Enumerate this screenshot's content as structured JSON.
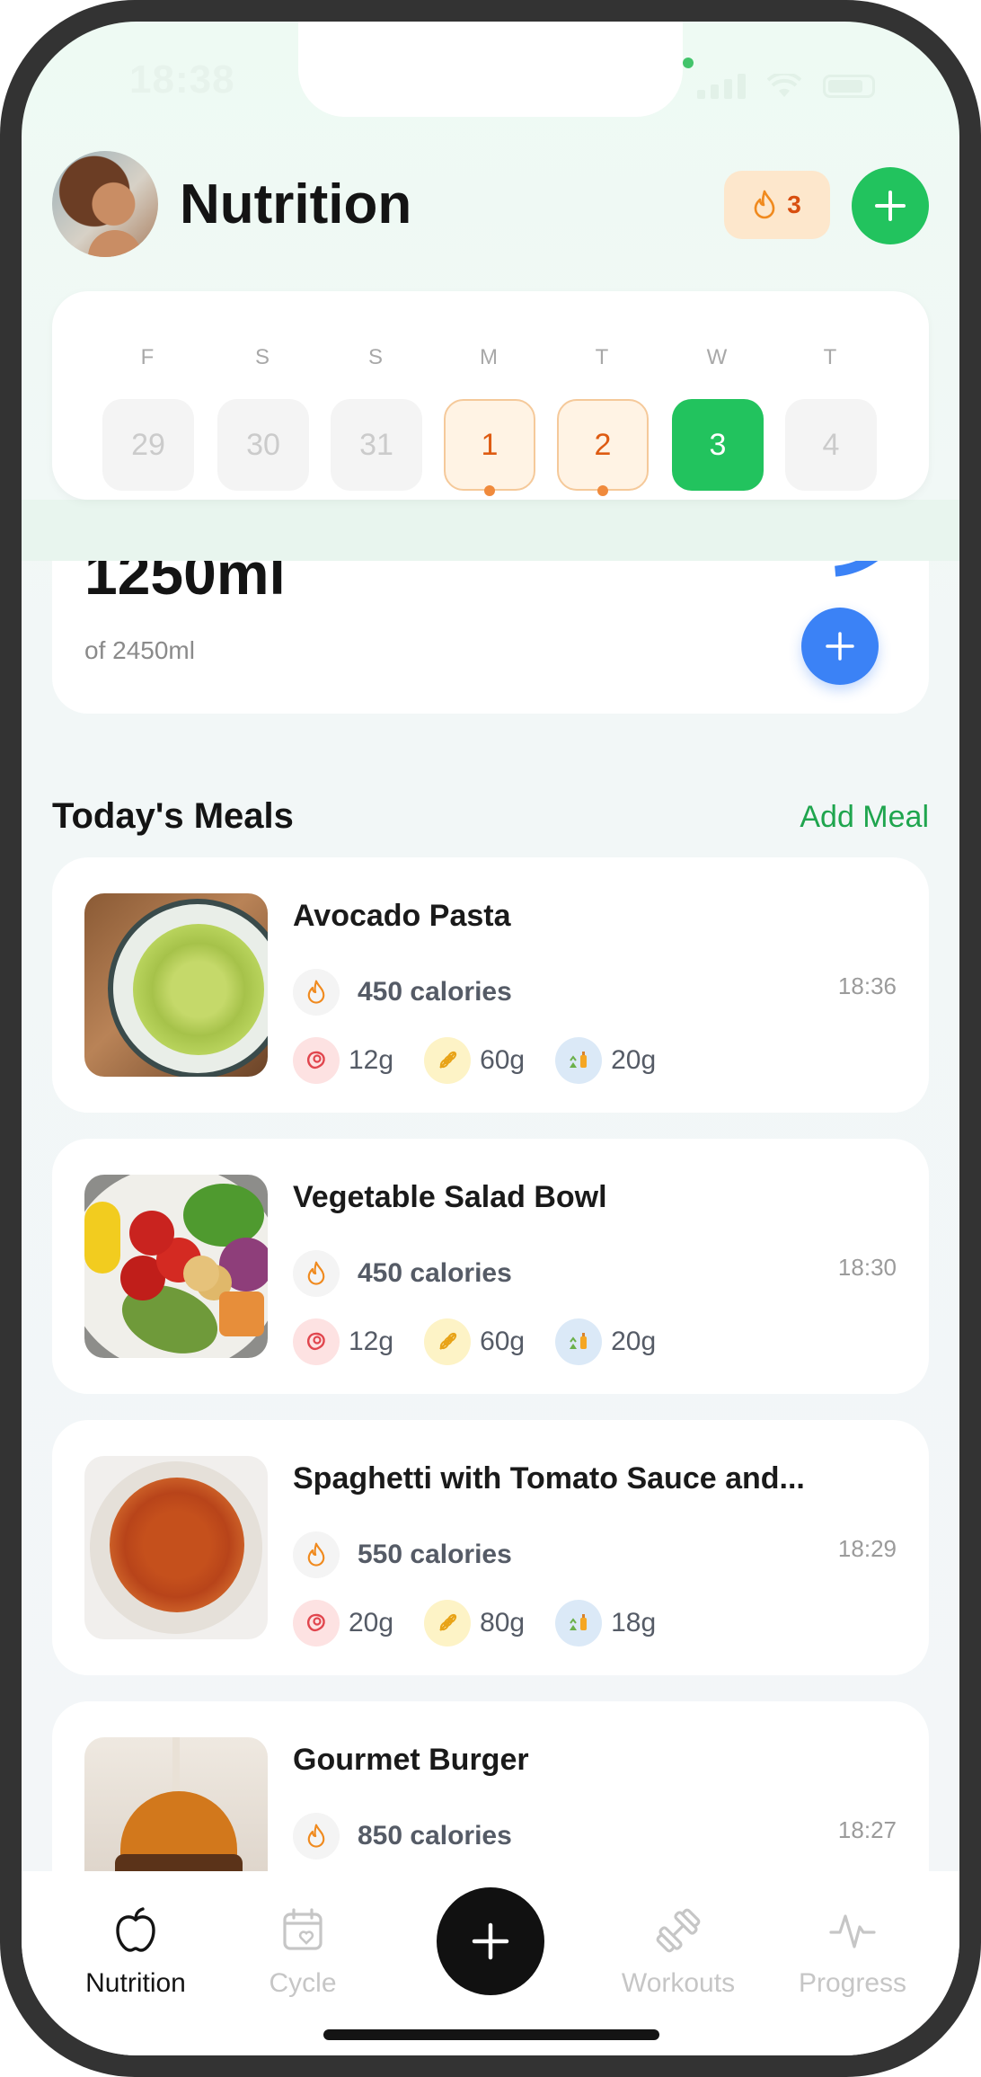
{
  "status": {
    "time": "18:38"
  },
  "header": {
    "title": "Nutrition",
    "streak_count": "3"
  },
  "calendar": {
    "days": [
      {
        "letter": "F",
        "date": "29",
        "state": "future-dim",
        "dot": false
      },
      {
        "letter": "S",
        "date": "30",
        "state": "future-dim",
        "dot": false
      },
      {
        "letter": "S",
        "date": "31",
        "state": "future-dim",
        "dot": false
      },
      {
        "letter": "M",
        "date": "1",
        "state": "logged",
        "dot": true
      },
      {
        "letter": "T",
        "date": "2",
        "state": "logged",
        "dot": true
      },
      {
        "letter": "W",
        "date": "3",
        "state": "selected",
        "dot": false
      },
      {
        "letter": "T",
        "date": "4",
        "state": "future-dim",
        "dot": false
      }
    ]
  },
  "water": {
    "amount": "1250ml",
    "goal": "of 2450ml",
    "progress_fraction": 0.51
  },
  "meals_section": {
    "title": "Today's Meals",
    "add_link": "Add Meal"
  },
  "meals": [
    {
      "name": "Avocado Pasta",
      "calories": "450 calories",
      "time": "18:36",
      "protein": "12g",
      "carbs": "60g",
      "fat": "20g"
    },
    {
      "name": "Vegetable Salad Bowl",
      "calories": "450 calories",
      "time": "18:30",
      "protein": "12g",
      "carbs": "60g",
      "fat": "20g"
    },
    {
      "name": "Spaghetti with Tomato Sauce and...",
      "calories": "550 calories",
      "time": "18:29",
      "protein": "20g",
      "carbs": "80g",
      "fat": "18g"
    },
    {
      "name": "Gourmet Burger",
      "calories": "850 calories",
      "time": "18:27",
      "protein": "",
      "carbs": "",
      "fat": ""
    }
  ],
  "tabs": [
    {
      "label": "Nutrition",
      "icon": "apple-icon",
      "active": true
    },
    {
      "label": "Cycle",
      "icon": "calendar-heart-icon",
      "active": false
    },
    {
      "label": "Workouts",
      "icon": "dumbbell-icon",
      "active": false
    },
    {
      "label": "Progress",
      "icon": "activity-icon",
      "active": false
    }
  ],
  "colors": {
    "accent_green": "#22c35e",
    "water_blue": "#3b82f6",
    "streak_orange": "#d84e0f"
  }
}
